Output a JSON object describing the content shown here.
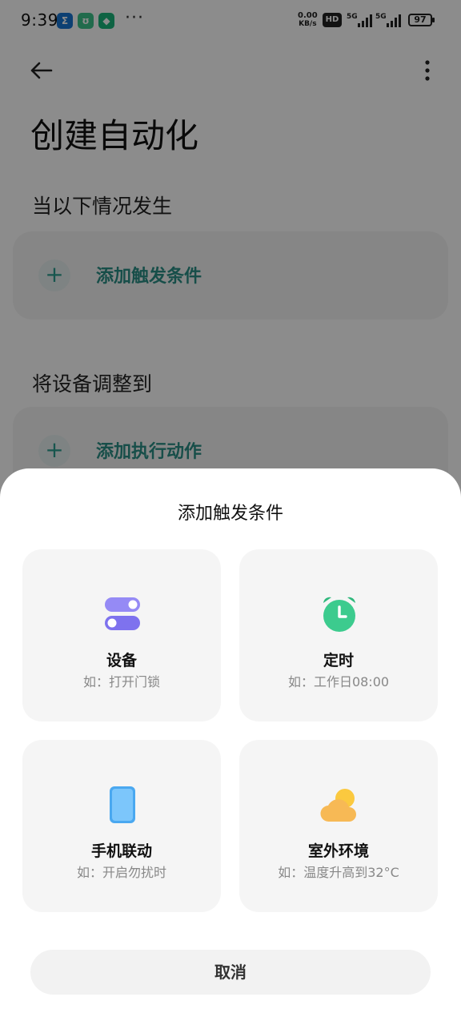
{
  "status_bar": {
    "time": "9:39",
    "app_icons": [
      {
        "name": "sigma-app-icon",
        "glyph": "Σ",
        "color": "#1976d2"
      },
      {
        "name": "mi-home-icon",
        "glyph": "ʊ",
        "color": "#3cc48a"
      },
      {
        "name": "shield-app-icon",
        "glyph": "◆",
        "color": "#1bb57a"
      }
    ],
    "more": "···",
    "net_speed_value": "0.00",
    "net_speed_unit": "KB/s",
    "hd_badge": "HD",
    "sig1_label": "5G",
    "sig2_label": "5G",
    "battery": "97"
  },
  "page": {
    "title": "创建自动化",
    "when_label": "当以下情况发生",
    "add_trigger_label": "添加触发条件",
    "then_label": "将设备调整到",
    "add_action_label": "添加执行动作"
  },
  "sheet": {
    "title": "添加触发条件",
    "options": [
      {
        "name": "设备",
        "desc": "如：打开门锁",
        "icon": "device-toggle-icon"
      },
      {
        "name": "定时",
        "desc": "如：工作日08:00",
        "icon": "alarm-clock-icon"
      },
      {
        "name": "手机联动",
        "desc": "如：开启勿扰时",
        "icon": "phone-icon"
      },
      {
        "name": "室外环境",
        "desc": "如：温度升高到32°C",
        "icon": "weather-cloud-icon"
      }
    ],
    "cancel_label": "取消"
  },
  "colors": {
    "accent_teal": "#2a8f86",
    "device_purple": "#8b7ff0",
    "clock_green": "#3ccb8e",
    "phone_blue": "#4aa8f0",
    "weather_yellow": "#f7c04a"
  }
}
